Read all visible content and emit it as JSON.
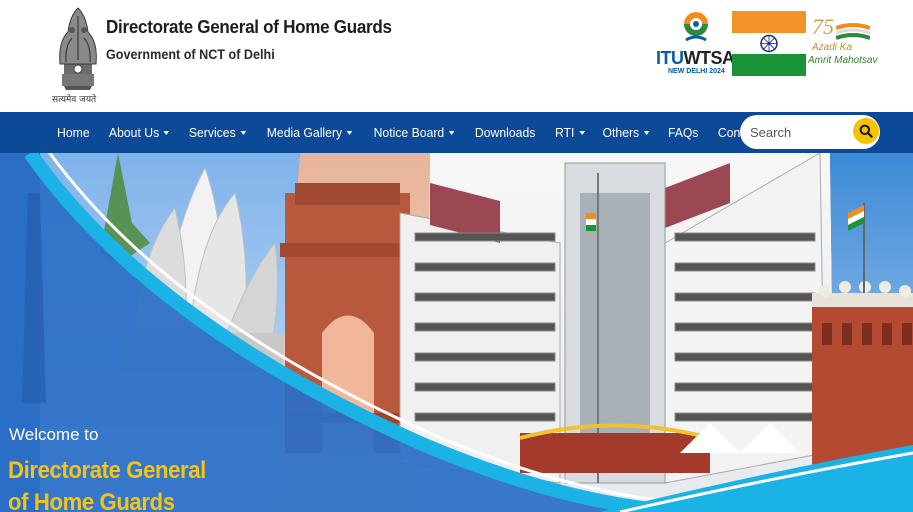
{
  "header": {
    "emblem_motto": "सत्यमेव जयते",
    "title": "Directorate General of Home Guards",
    "subtitle": "Government of NCT of Delhi",
    "itu_logo": {
      "brand_a": "ITU",
      "brand_b": "WTSA",
      "location": "NEW DELHI 2024"
    },
    "azadi_logo": {
      "number": "75",
      "line1": "Azadi Ka",
      "line2": "Amrit Mahotsav"
    }
  },
  "nav": {
    "items": [
      {
        "label": "Home",
        "dropdown": false
      },
      {
        "label": "About Us",
        "dropdown": true
      },
      {
        "label": "Services",
        "dropdown": true
      },
      {
        "label": "Media Gallery",
        "dropdown": true
      },
      {
        "label": "Notice Board",
        "dropdown": true
      },
      {
        "label": "Downloads",
        "dropdown": false
      },
      {
        "label": "RTI",
        "dropdown": true
      },
      {
        "label": "Others",
        "dropdown": true
      },
      {
        "label": "FAQs",
        "dropdown": false
      },
      {
        "label": "Contact us",
        "dropdown": false
      }
    ],
    "search": {
      "placeholder": "Search",
      "value": "",
      "icon": "search-icon"
    }
  },
  "banner": {
    "welcome": "Welcome to",
    "heading_line1": "Directorate General",
    "heading_line2": "of Home Guards"
  },
  "colors": {
    "nav_bg": "#0c4a97",
    "search_button": "#f5c400",
    "banner_heading": "#f3c414",
    "banner_blue": "#3b74c4",
    "swoosh": "#1bb3e6"
  }
}
